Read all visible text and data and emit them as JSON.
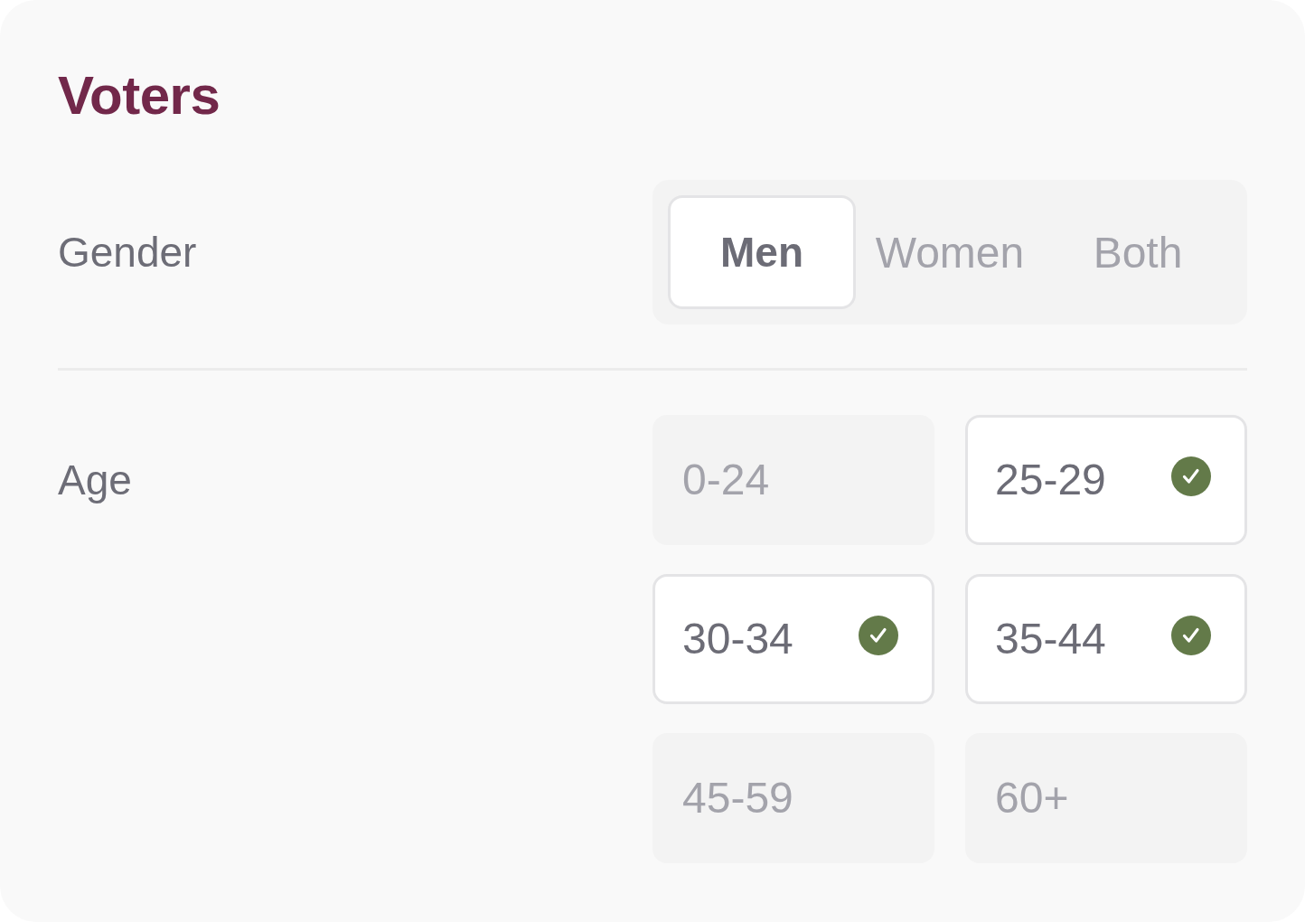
{
  "title": "Voters",
  "gender": {
    "label": "Gender",
    "options": [
      {
        "label": "Men",
        "selected": true
      },
      {
        "label": "Women",
        "selected": false
      },
      {
        "label": "Both",
        "selected": false
      }
    ]
  },
  "age": {
    "label": "Age",
    "options": [
      {
        "label": "0-24",
        "checked": false
      },
      {
        "label": "25-29",
        "checked": true
      },
      {
        "label": "30-34",
        "checked": true
      },
      {
        "label": "35-44",
        "checked": true
      },
      {
        "label": "45-59",
        "checked": false
      },
      {
        "label": "60+",
        "checked": false
      }
    ]
  }
}
